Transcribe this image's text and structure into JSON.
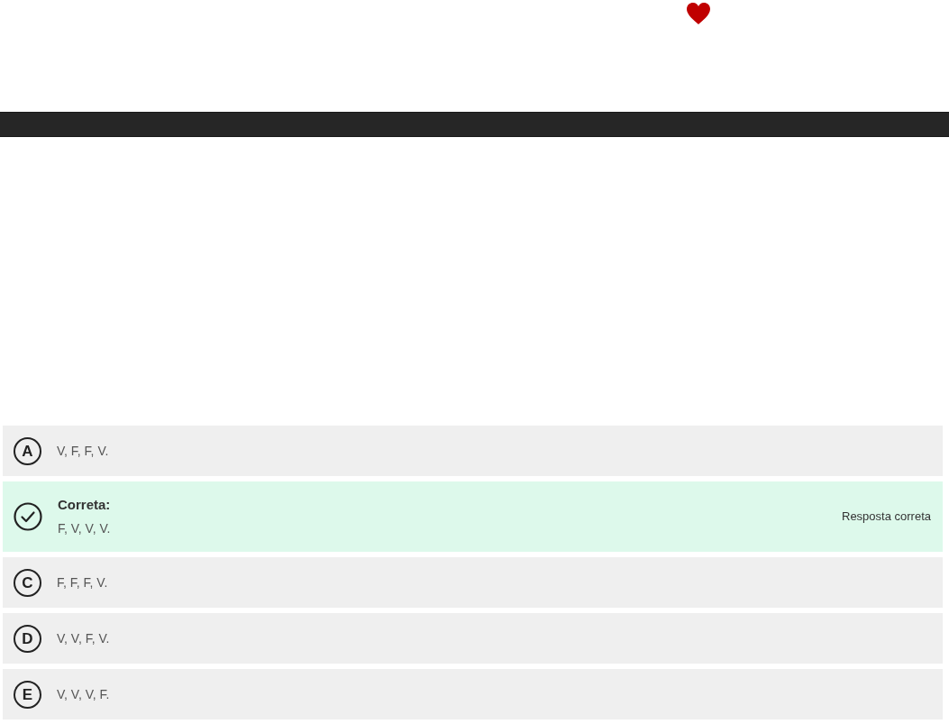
{
  "options": [
    {
      "kind": "letter",
      "letter": "A",
      "text": "V, F, F, V."
    },
    {
      "kind": "correct",
      "label": "Correta:",
      "text": "F, V, V, V.",
      "status": "Resposta correta"
    },
    {
      "kind": "letter",
      "letter": "C",
      "text": "F, F, F, V."
    },
    {
      "kind": "letter",
      "letter": "D",
      "text": "V, V, F, V."
    },
    {
      "kind": "letter",
      "letter": "E",
      "text": "V, V, V, F."
    }
  ]
}
